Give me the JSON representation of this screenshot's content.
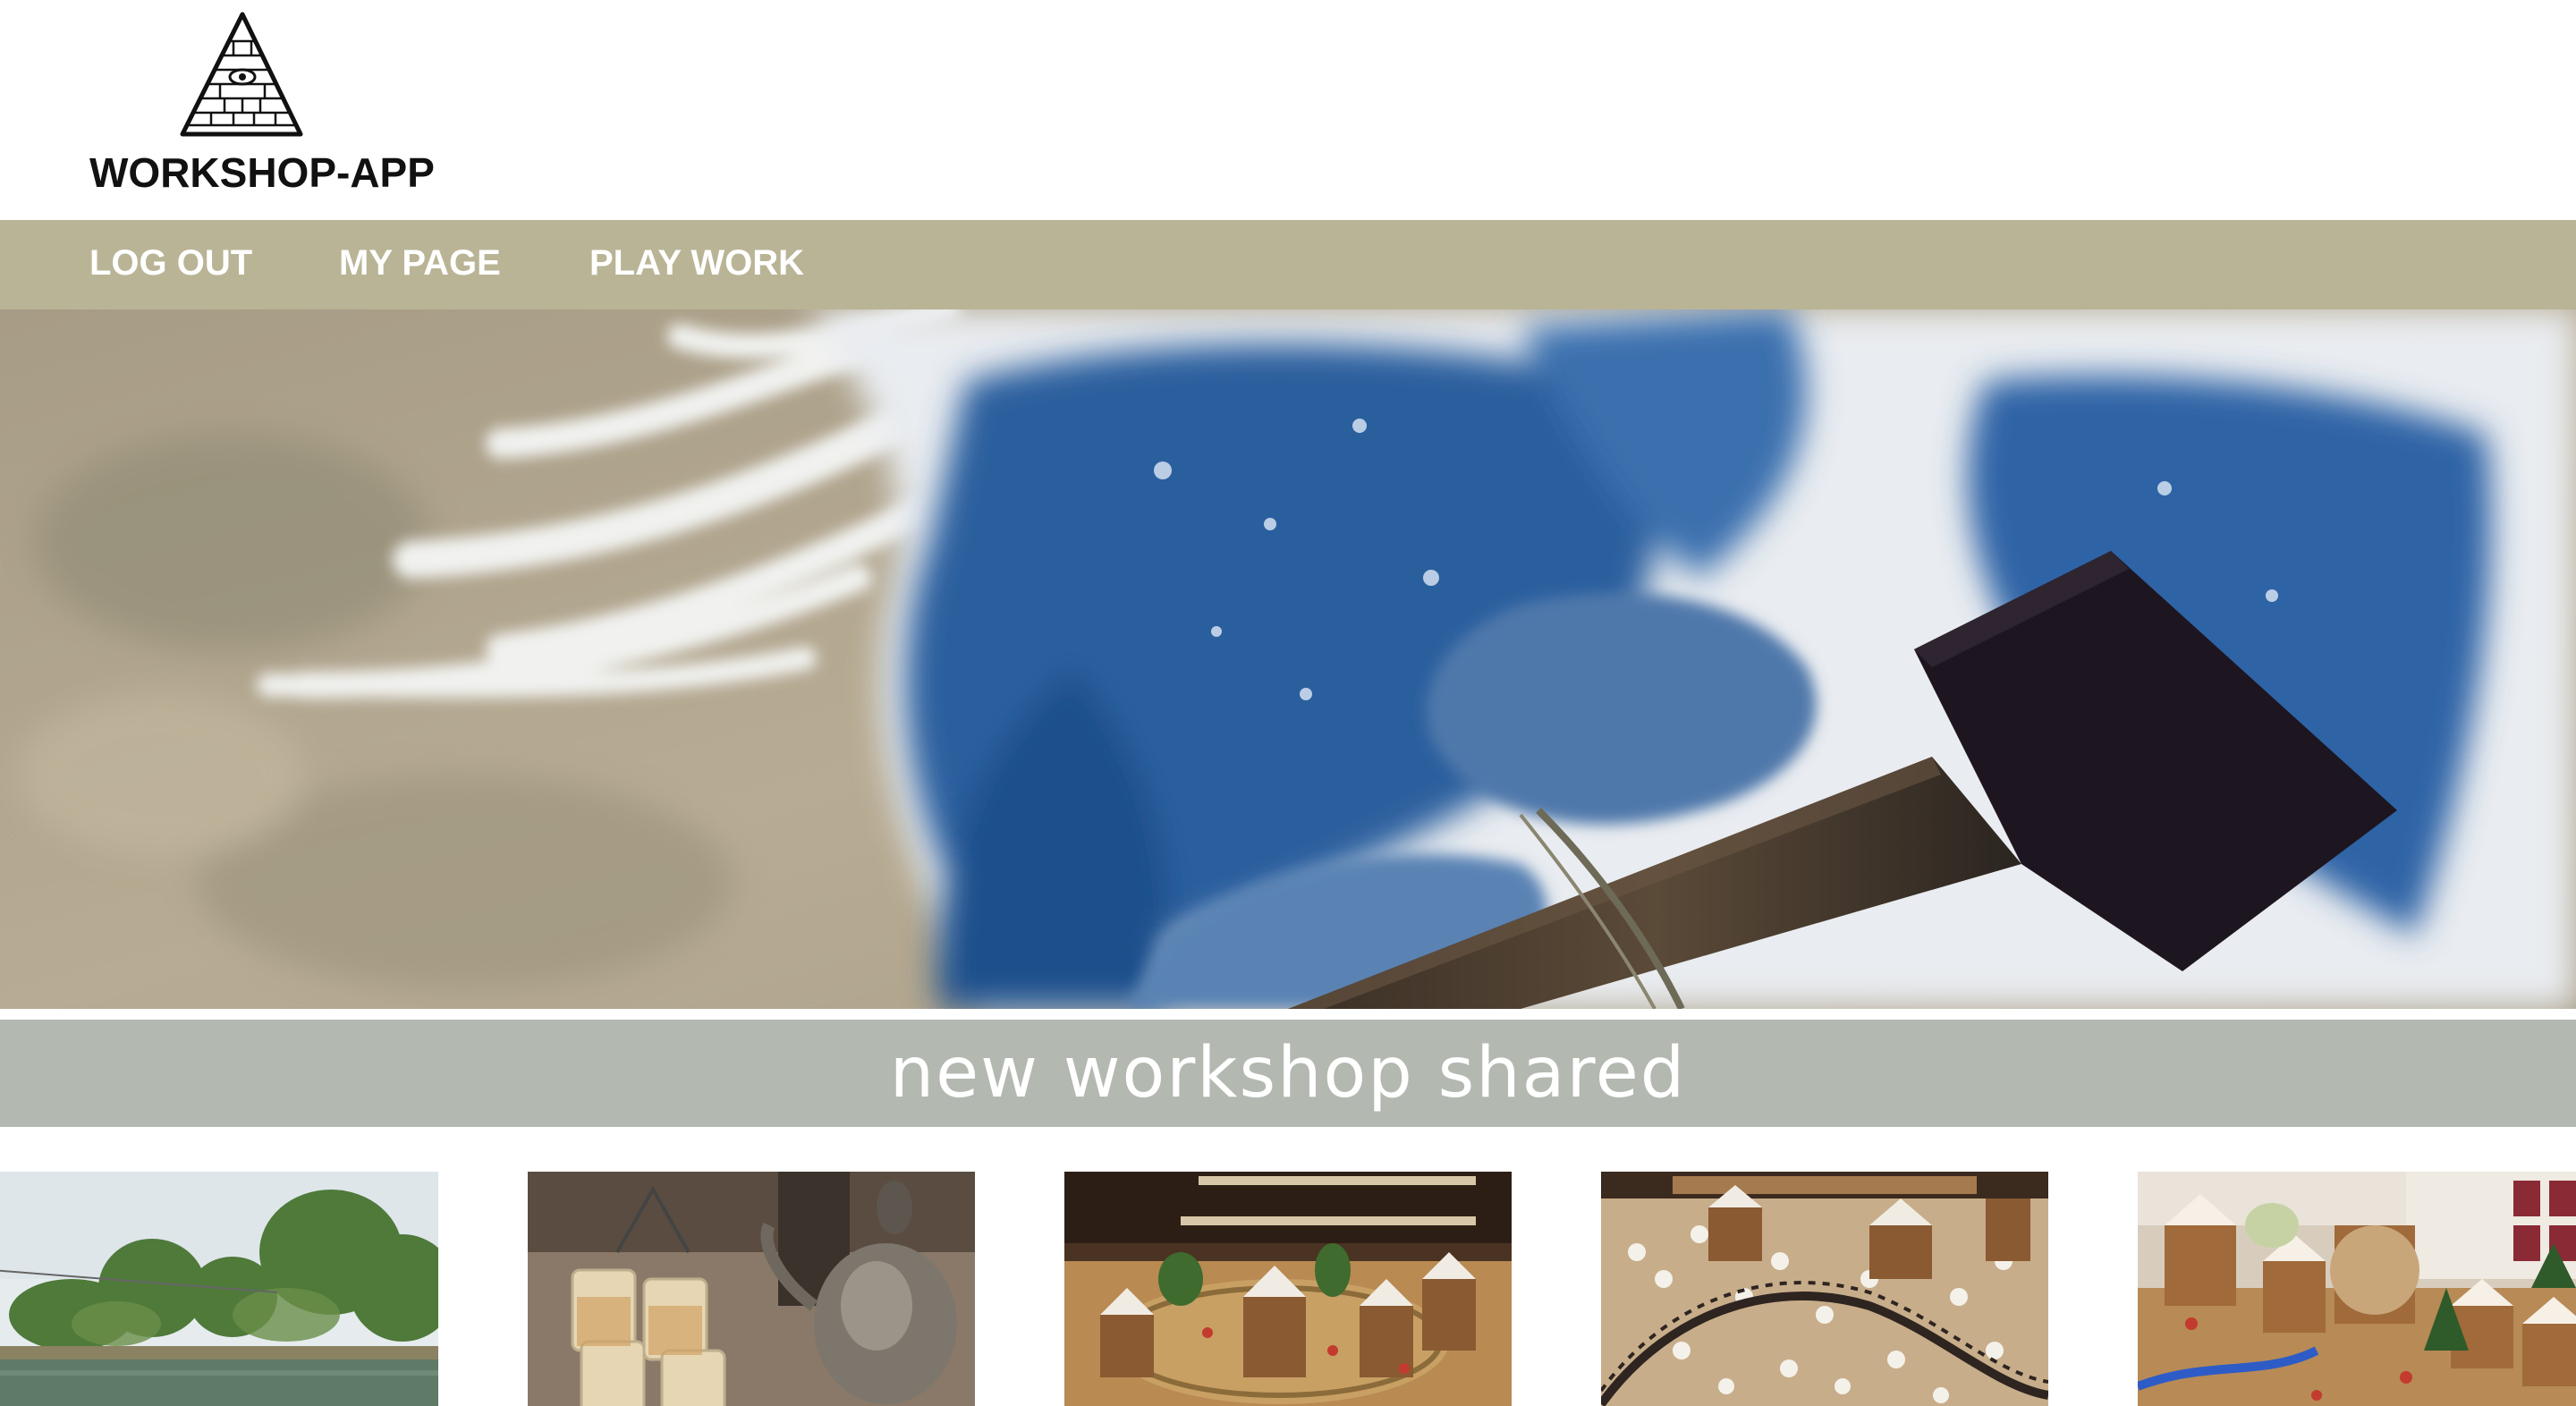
{
  "header": {
    "brand_name": "WORKSHOP-APP",
    "logo_icon": "pyramid-eye-icon"
  },
  "nav": {
    "background": "#b9b496",
    "items": [
      {
        "label": "LOG OUT"
      },
      {
        "label": "MY PAGE"
      },
      {
        "label": "PLAY WORK"
      }
    ]
  },
  "hero": {
    "image": "indigo-dyed-cloth-with-wooden-block-photo"
  },
  "section": {
    "title": "new workshop shared",
    "background": "#b3b8b0"
  },
  "gallery": {
    "items": [
      {
        "image": "river-and-trees-photo"
      },
      {
        "image": "tea-glasses-and-kettle-photo"
      },
      {
        "image": "gingerbread-village-display-photo"
      },
      {
        "image": "gingerbread-train-set-photo"
      },
      {
        "image": "gingerbread-houses-shop-photo"
      }
    ]
  }
}
